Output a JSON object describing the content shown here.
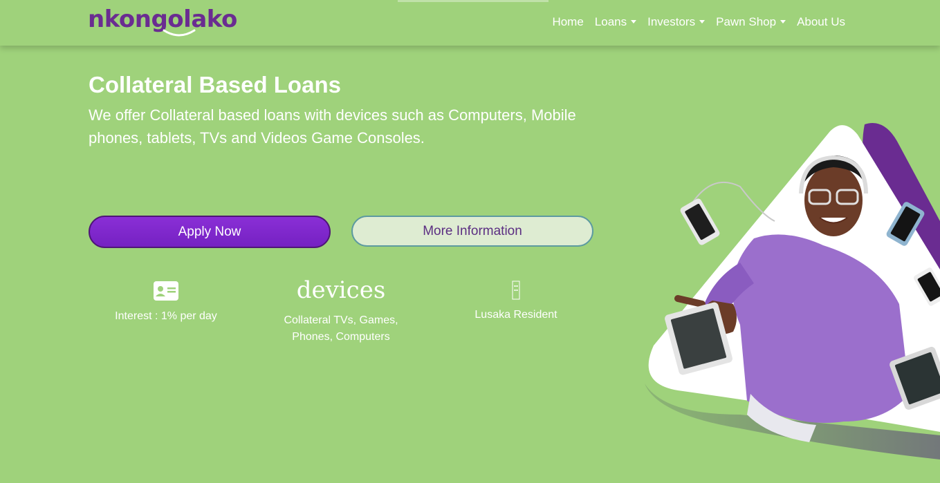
{
  "brand": {
    "name": "nkongolako",
    "color": "#6a2c91",
    "accent": "#9fd27b"
  },
  "nav": {
    "items": [
      {
        "label": "Home",
        "dropdown": false
      },
      {
        "label": "Loans",
        "dropdown": true
      },
      {
        "label": "Investors",
        "dropdown": true
      },
      {
        "label": "Pawn Shop",
        "dropdown": true
      },
      {
        "label": "About Us",
        "dropdown": false
      }
    ]
  },
  "hero": {
    "title": "Collateral Based Loans",
    "subtitle": "We offer Collateral based loans with devices such as Computers, Mobile phones, tablets, TVs and Videos Game Consoles.",
    "apply_label": "Apply Now",
    "more_label": "More Information"
  },
  "features": [
    {
      "icon": "id-card-icon",
      "heading": "",
      "text": "Interest : 1% per day"
    },
    {
      "icon": "",
      "heading": "devices",
      "text": "Collateral TVs, Games, Phones, Computers"
    },
    {
      "icon": "missing-glyph-icon",
      "heading": "",
      "text": "Lusaka Resident"
    }
  ]
}
